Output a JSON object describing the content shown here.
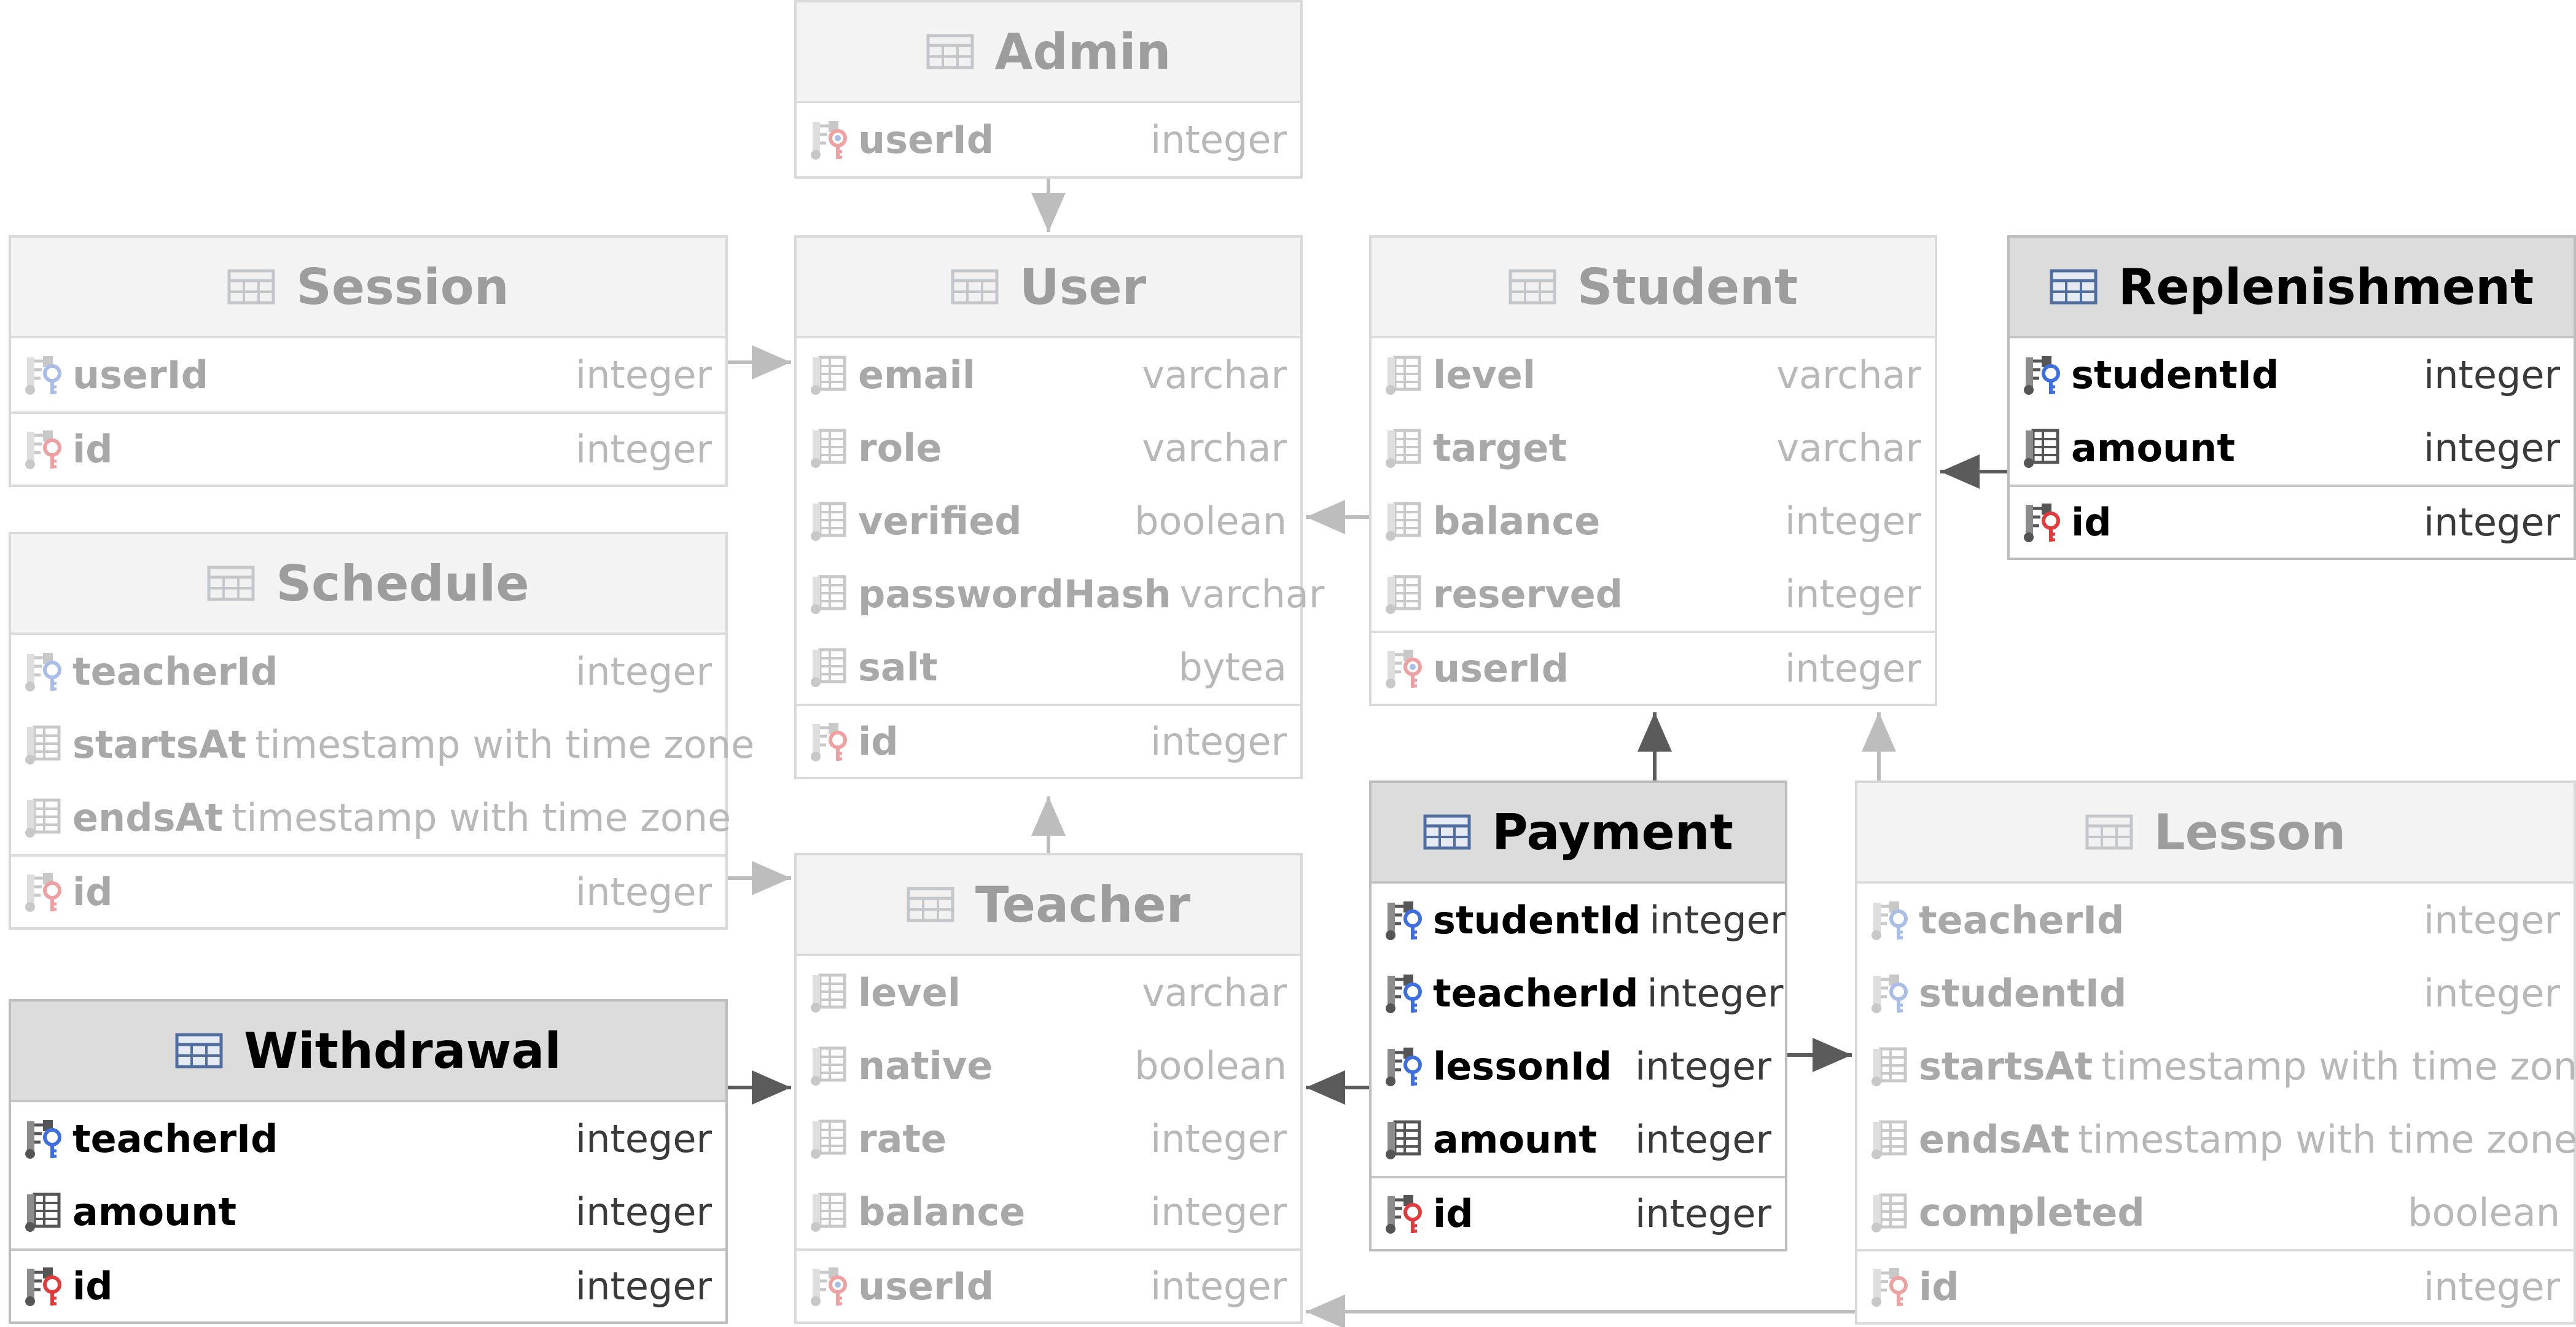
{
  "tables": [
    {
      "name": "Admin",
      "active": false,
      "columns": [
        {
          "name": "userId",
          "type": "integer",
          "kind": "pk-fk"
        }
      ]
    },
    {
      "name": "Session",
      "active": false,
      "columns": [
        {
          "name": "userId",
          "type": "integer",
          "kind": "fk"
        },
        {
          "name": "id",
          "type": "integer",
          "kind": "pk"
        }
      ]
    },
    {
      "name": "User",
      "active": false,
      "columns": [
        {
          "name": "email",
          "type": "varchar",
          "kind": "col"
        },
        {
          "name": "role",
          "type": "varchar",
          "kind": "col"
        },
        {
          "name": "verified",
          "type": "boolean",
          "kind": "col"
        },
        {
          "name": "passwordHash",
          "type": "varchar",
          "kind": "col"
        },
        {
          "name": "salt",
          "type": "bytea",
          "kind": "col"
        },
        {
          "name": "id",
          "type": "integer",
          "kind": "pk"
        }
      ]
    },
    {
      "name": "Student",
      "active": false,
      "columns": [
        {
          "name": "level",
          "type": "varchar",
          "kind": "col"
        },
        {
          "name": "target",
          "type": "varchar",
          "kind": "col"
        },
        {
          "name": "balance",
          "type": "integer",
          "kind": "col"
        },
        {
          "name": "reserved",
          "type": "integer",
          "kind": "col"
        },
        {
          "name": "userId",
          "type": "integer",
          "kind": "pk-fk"
        }
      ]
    },
    {
      "name": "Replenishment",
      "active": true,
      "columns": [
        {
          "name": "studentId",
          "type": "integer",
          "kind": "fk"
        },
        {
          "name": "amount",
          "type": "integer",
          "kind": "col"
        },
        {
          "name": "id",
          "type": "integer",
          "kind": "pk"
        }
      ]
    },
    {
      "name": "Schedule",
      "active": false,
      "columns": [
        {
          "name": "teacherId",
          "type": "integer",
          "kind": "fk"
        },
        {
          "name": "startsAt",
          "type": "timestamp with time zone",
          "kind": "col"
        },
        {
          "name": "endsAt",
          "type": "timestamp with time zone",
          "kind": "col"
        },
        {
          "name": "id",
          "type": "integer",
          "kind": "pk"
        }
      ]
    },
    {
      "name": "Withdrawal",
      "active": true,
      "columns": [
        {
          "name": "teacherId",
          "type": "integer",
          "kind": "fk"
        },
        {
          "name": "amount",
          "type": "integer",
          "kind": "col"
        },
        {
          "name": "id",
          "type": "integer",
          "kind": "pk"
        }
      ]
    },
    {
      "name": "Teacher",
      "active": false,
      "columns": [
        {
          "name": "level",
          "type": "varchar",
          "kind": "col"
        },
        {
          "name": "native",
          "type": "boolean",
          "kind": "col"
        },
        {
          "name": "rate",
          "type": "integer",
          "kind": "col"
        },
        {
          "name": "balance",
          "type": "integer",
          "kind": "col"
        },
        {
          "name": "userId",
          "type": "integer",
          "kind": "pk-fk"
        }
      ]
    },
    {
      "name": "Payment",
      "active": true,
      "columns": [
        {
          "name": "studentId",
          "type": "integer",
          "kind": "fk"
        },
        {
          "name": "teacherId",
          "type": "integer",
          "kind": "fk"
        },
        {
          "name": "lessonId",
          "type": "integer",
          "kind": "fk"
        },
        {
          "name": "amount",
          "type": "integer",
          "kind": "col"
        },
        {
          "name": "id",
          "type": "integer",
          "kind": "pk"
        }
      ]
    },
    {
      "name": "Lesson",
      "active": false,
      "columns": [
        {
          "name": "teacherId",
          "type": "integer",
          "kind": "fk"
        },
        {
          "name": "studentId",
          "type": "integer",
          "kind": "fk"
        },
        {
          "name": "startsAt",
          "type": "timestamp with time zone",
          "kind": "col"
        },
        {
          "name": "endsAt",
          "type": "timestamp with time zone",
          "kind": "col"
        },
        {
          "name": "completed",
          "type": "boolean",
          "kind": "col"
        },
        {
          "name": "id",
          "type": "integer",
          "kind": "pk"
        }
      ]
    }
  ],
  "relations": [
    {
      "from": "Admin",
      "to": "User",
      "active": false
    },
    {
      "from": "Session",
      "to": "User",
      "active": false
    },
    {
      "from": "Student",
      "to": "User",
      "active": false
    },
    {
      "from": "Teacher",
      "to": "User",
      "active": false
    },
    {
      "from": "Replenishment",
      "to": "Student",
      "active": true
    },
    {
      "from": "Schedule",
      "to": "Teacher",
      "active": false
    },
    {
      "from": "Withdrawal",
      "to": "Teacher",
      "active": true
    },
    {
      "from": "Payment",
      "to": "Student",
      "active": true
    },
    {
      "from": "Payment",
      "to": "Teacher",
      "active": true
    },
    {
      "from": "Payment",
      "to": "Lesson",
      "active": true
    },
    {
      "from": "Lesson",
      "to": "Student",
      "active": false
    },
    {
      "from": "Lesson",
      "to": "Teacher",
      "active": false
    }
  ],
  "colors": {
    "fk_key": "#3d6fe0",
    "pk_key": "#e23b3b",
    "active_line": "#5b5b5b",
    "inactive_line": "#bdbdbd"
  },
  "icons": {
    "table": "table-icon",
    "column": "column-icon",
    "primary_key": "primary-key-icon",
    "foreign_key": "foreign-key-icon",
    "primary_foreign_key": "primary-foreign-key-icon"
  }
}
